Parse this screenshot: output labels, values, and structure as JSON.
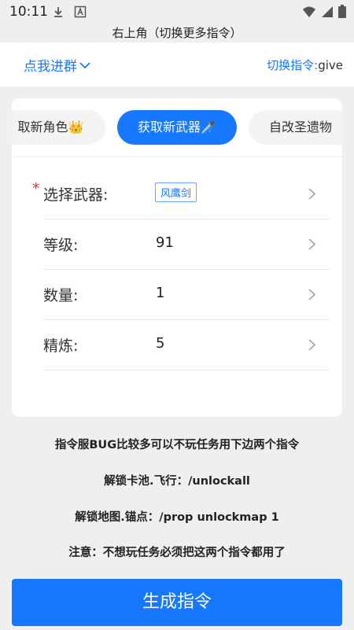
{
  "status_bar": {
    "time": "10:11",
    "icons": [
      "download-icon",
      "font-icon",
      "wifi-icon",
      "signal-icon",
      "battery-icon"
    ]
  },
  "hint": "右上角（切换更多指令）",
  "header": {
    "join_group": "点我进群",
    "switch_label": "切换指令:",
    "switch_value": "give"
  },
  "tabs": [
    {
      "label": "取新角色👑",
      "active": false
    },
    {
      "label": "获取新武器🗡️",
      "active": true
    },
    {
      "label": "自改圣遗物",
      "active": false
    }
  ],
  "form": {
    "weapon": {
      "label": "选择武器:",
      "value": "风鹰剑",
      "required": true
    },
    "level": {
      "label": "等级:",
      "value": "91"
    },
    "count": {
      "label": "数量:",
      "value": "1"
    },
    "refine": {
      "label": "精炼:",
      "value": "5"
    }
  },
  "notes": {
    "line1": "指令服BUG比较多可以不玩任务用下边两个指令",
    "line2": "解锁卡池.飞行：/unlockall",
    "line3": "解锁地图.锚点：/prop unlockmap 1",
    "line4": "注意：不想玩任务必须把这两个指令都用了"
  },
  "generate_button": "生成指令",
  "colors": {
    "accent": "#1677ff",
    "background": "#efefef",
    "required": "#e03030"
  }
}
